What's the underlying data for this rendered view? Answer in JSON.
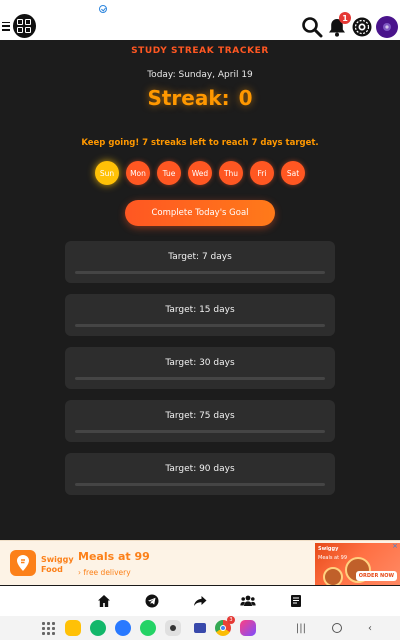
{
  "header": {
    "icons": [
      "menu-icon",
      "grid-icon",
      "verified-icon",
      "search-icon",
      "bell-icon",
      "settings-icon",
      "avatar-icon"
    ],
    "notification_count": "1"
  },
  "tracker": {
    "title": "STUDY STREAK TRACKER",
    "today": "Today: Sunday, April 19",
    "streak_label": "Streak:",
    "streak_value": "0",
    "message": "Keep going! 7 streaks left to reach 7 days target.",
    "days": [
      "Sun",
      "Mon",
      "Tue",
      "Wed",
      "Thu",
      "Fri",
      "Sat"
    ],
    "current_day": "Sun",
    "goal_button": "Complete Today's Goal",
    "targets": [
      {
        "label": "Target: 7 days",
        "progress": 0
      },
      {
        "label": "Target: 15 days",
        "progress": 0
      },
      {
        "label": "Target: 30 days",
        "progress": 0
      },
      {
        "label": "Target: 75 days",
        "progress": 0
      },
      {
        "label": "Target: 90 days",
        "progress": 0
      }
    ],
    "colors": {
      "accent": "#ff5722",
      "streak": "#ff9800",
      "today": "#ffc107",
      "background": "#1c1c1c",
      "card": "#2d2d2d"
    }
  },
  "ad": {
    "brand_line1": "Swiggy",
    "brand_line2": "Food",
    "headline": "Meals at 99",
    "subline": "› free delivery",
    "image_brand": "Swiggy",
    "image_text": "Meals at 99",
    "image_cta": "ORDER NOW",
    "color": "#fc8019"
  },
  "bottom_nav": {
    "items": [
      "home-icon",
      "telegram-icon",
      "share-icon",
      "group-icon",
      "notes-icon"
    ]
  },
  "system_bar": {
    "apps": [
      "app-drawer-icon",
      "files-icon",
      "phone-icon",
      "messages-icon",
      "whatsapp-icon",
      "camera-icon",
      "email-icon",
      "chrome-icon",
      "gallery-icon"
    ],
    "chrome_badge": "3",
    "nav": [
      "recents-icon",
      "home-circle-icon",
      "back-icon"
    ]
  }
}
